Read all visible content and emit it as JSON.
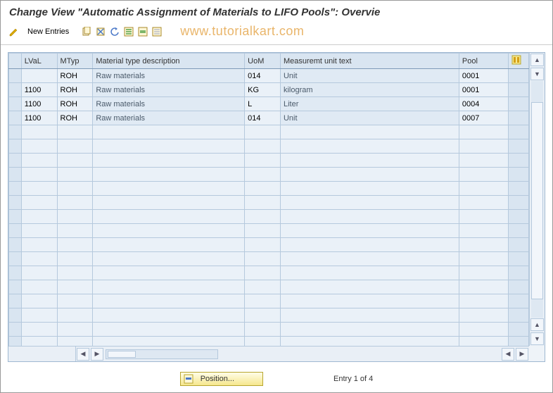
{
  "title": "Change View \"Automatic Assignment of Materials to LIFO Pools\": Overvie",
  "watermark": "www.tutorialkart.com",
  "toolbar": {
    "new_entries_label": "New Entries"
  },
  "columns": {
    "lval": "LVaL",
    "mtyp": "MTyp",
    "desc": "Material type description",
    "uom": "UoM",
    "mut": "Measuremt unit text",
    "pool": "Pool"
  },
  "rows": [
    {
      "lval": "",
      "mtyp": "ROH",
      "desc": "Raw materials",
      "uom": "014",
      "mut": "Unit",
      "pool": "0001"
    },
    {
      "lval": "1100",
      "mtyp": "ROH",
      "desc": "Raw materials",
      "uom": "KG",
      "mut": "kilogram",
      "pool": "0001"
    },
    {
      "lval": "1100",
      "mtyp": "ROH",
      "desc": "Raw materials",
      "uom": "L",
      "mut": "Liter",
      "pool": "0004"
    },
    {
      "lval": "1100",
      "mtyp": "ROH",
      "desc": "Raw materials",
      "uom": "014",
      "mut": "Unit",
      "pool": "0007"
    }
  ],
  "empty_rows": 16,
  "footer": {
    "position_label": "Position...",
    "entry_text": "Entry 1 of 4"
  }
}
